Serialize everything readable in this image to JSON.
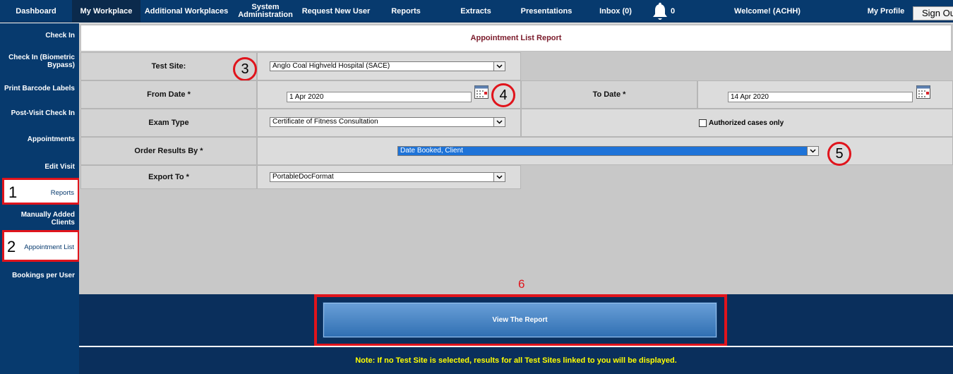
{
  "topnav": {
    "items": [
      "Dashboard",
      "My Workplace",
      "Additional Workplaces",
      "System Administration",
      "Request New User",
      "Reports",
      "Extracts",
      "Presentations",
      "Inbox (0)"
    ],
    "bell_count": "0",
    "welcome": "Welcome! (ACHH)",
    "my_profile": "My Profile",
    "sign_out": "Sign Out"
  },
  "sidebar": {
    "items": [
      "Check In",
      "Check In (Biometric Bypass)",
      "Print Barcode Labels",
      "Post-Visit Check In",
      "Appointments",
      "Edit Visit",
      "Reports",
      "Manually Added Clients",
      "Appointment List",
      "Bookings per User"
    ]
  },
  "annotations": {
    "n1": "1",
    "n2": "2",
    "n3": "3",
    "n4": "4",
    "n5": "5",
    "n6": "6"
  },
  "report": {
    "title": "Appointment List Report",
    "test_site_label": "Test Site:",
    "test_site_value": "Anglo Coal Highveld Hospital (SACE)",
    "from_date_label": "From Date *",
    "from_date_value": "1 Apr 2020",
    "to_date_label": "To Date *",
    "to_date_value": "14 Apr 2020",
    "exam_type_label": "Exam Type",
    "exam_type_value": "Certificate of Fitness Consultation",
    "authorized_label": "Authorized cases only",
    "order_label": "Order Results By *",
    "order_value": "Date Booked, Client",
    "export_label": "Export To *",
    "export_value": "PortableDocFormat",
    "view_button": "View The Report",
    "note": "Note: If no Test Site is selected, results for all Test Sites linked to you will be displayed."
  },
  "colors": {
    "nav": "#073a6e",
    "accent_red": "#e0141c",
    "note_text": "#ffff00",
    "title_text": "#7a1a2a"
  },
  "icons": [
    "bell-icon",
    "calendar-icon",
    "chevron-down-icon"
  ]
}
